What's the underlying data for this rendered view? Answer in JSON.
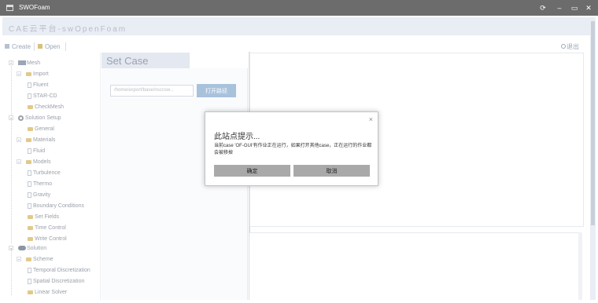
{
  "window": {
    "title": "SWOFoam",
    "controls": [
      "⟳",
      "–",
      "▭",
      "✕"
    ]
  },
  "brand": {
    "text": "CAE云平台-swOpenFoam"
  },
  "toolbar": {
    "create_label": "Create",
    "open_label": "Open",
    "exit_label": "退出"
  },
  "sidebar": {
    "items": [
      {
        "label": "Mesh"
      },
      {
        "label": "Import"
      },
      {
        "label": "Fluent"
      },
      {
        "label": "STAR-CD"
      },
      {
        "label": "CheckMesh"
      },
      {
        "label": "Solution Setup"
      },
      {
        "label": "General"
      },
      {
        "label": "Materials"
      },
      {
        "label": "Fluid"
      },
      {
        "label": "Models"
      },
      {
        "label": "Turbulence"
      },
      {
        "label": "Thermo"
      },
      {
        "label": "Gravity"
      },
      {
        "label": "Boundary Conditions"
      },
      {
        "label": "Set Fields"
      },
      {
        "label": "Time Control"
      },
      {
        "label": "Write Control"
      },
      {
        "label": "Solution"
      },
      {
        "label": "Scheme"
      },
      {
        "label": "Temporal Discretization"
      },
      {
        "label": "Spatial Discretization"
      },
      {
        "label": "Linear Solver"
      }
    ]
  },
  "setcase": {
    "tab_label": "Set Case",
    "path_value": "/home/export/base/nsccsw...",
    "open_button": "打开路径"
  },
  "modal": {
    "close": "×",
    "heading": "此站点提示...",
    "message": "当前case 'OF-GUI'有作业正在运行，如果打开其他case，正在运行的作业都会被移掉",
    "ok": "确定",
    "cancel": "取消"
  }
}
